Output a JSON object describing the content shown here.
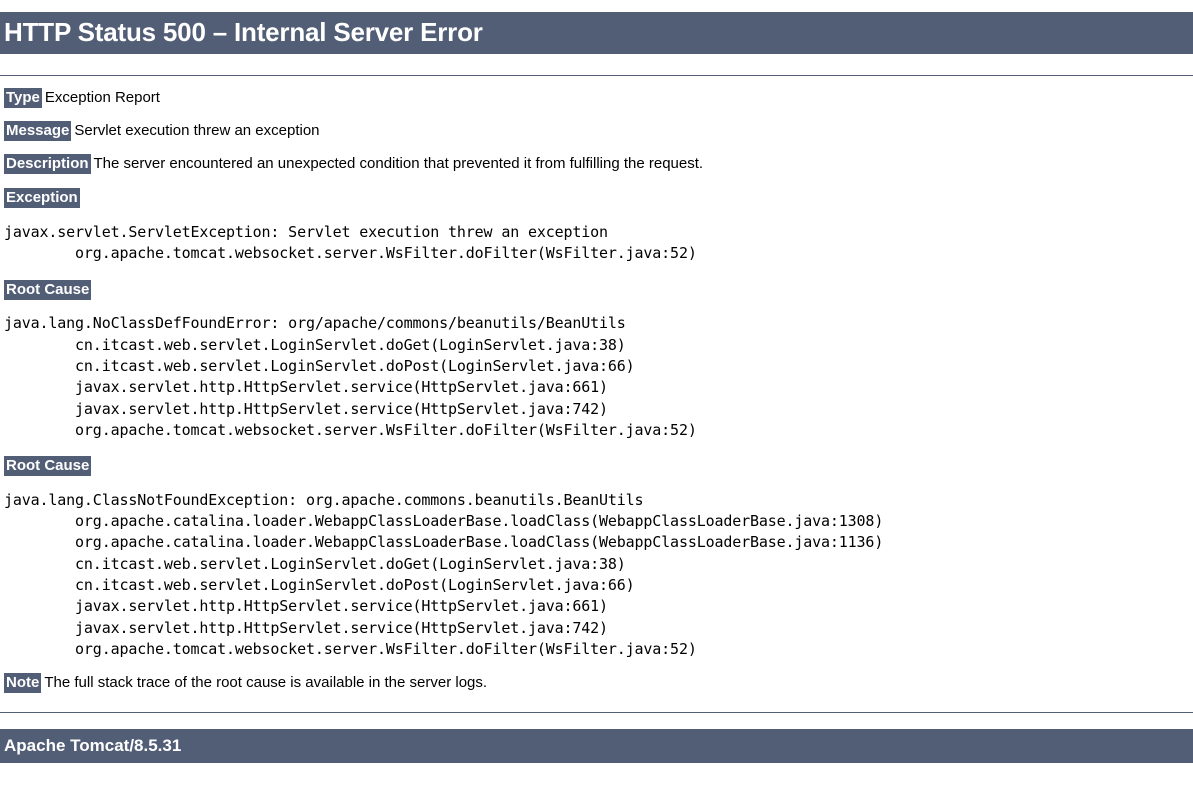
{
  "page": {
    "title": "HTTP Status 500 – Internal Server Error",
    "server_signature": "Apache Tomcat/8.5.31"
  },
  "fields": {
    "type": {
      "label": "Type",
      "value": "Exception Report"
    },
    "message": {
      "label": "Message",
      "value": "Servlet execution threw an exception"
    },
    "description": {
      "label": "Description",
      "value": "The server encountered an unexpected condition that prevented it from fulfilling the request."
    },
    "note": {
      "label": "Note",
      "value": "The full stack trace of the root cause is available in the server logs."
    }
  },
  "sections": {
    "exception": {
      "heading": "Exception",
      "trace": "javax.servlet.ServletException: Servlet execution threw an exception\n        org.apache.tomcat.websocket.server.WsFilter.doFilter(WsFilter.java:52)"
    },
    "root_cause_1": {
      "heading": "Root Cause",
      "trace": "java.lang.NoClassDefFoundError: org/apache/commons/beanutils/BeanUtils\n        cn.itcast.web.servlet.LoginServlet.doGet(LoginServlet.java:38)\n        cn.itcast.web.servlet.LoginServlet.doPost(LoginServlet.java:66)\n        javax.servlet.http.HttpServlet.service(HttpServlet.java:661)\n        javax.servlet.http.HttpServlet.service(HttpServlet.java:742)\n        org.apache.tomcat.websocket.server.WsFilter.doFilter(WsFilter.java:52)"
    },
    "root_cause_2": {
      "heading": "Root Cause",
      "trace": "java.lang.ClassNotFoundException: org.apache.commons.beanutils.BeanUtils\n        org.apache.catalina.loader.WebappClassLoaderBase.loadClass(WebappClassLoaderBase.java:1308)\n        org.apache.catalina.loader.WebappClassLoaderBase.loadClass(WebappClassLoaderBase.java:1136)\n        cn.itcast.web.servlet.LoginServlet.doGet(LoginServlet.java:38)\n        cn.itcast.web.servlet.LoginServlet.doPost(LoginServlet.java:66)\n        javax.servlet.http.HttpServlet.service(HttpServlet.java:661)\n        javax.servlet.http.HttpServlet.service(HttpServlet.java:742)\n        org.apache.tomcat.websocket.server.WsFilter.doFilter(WsFilter.java:52)"
    }
  },
  "colors": {
    "banner_background": "#525D76",
    "banner_text": "#FFFFFF",
    "body_text": "#000000",
    "page_background": "#FFFFFF"
  }
}
